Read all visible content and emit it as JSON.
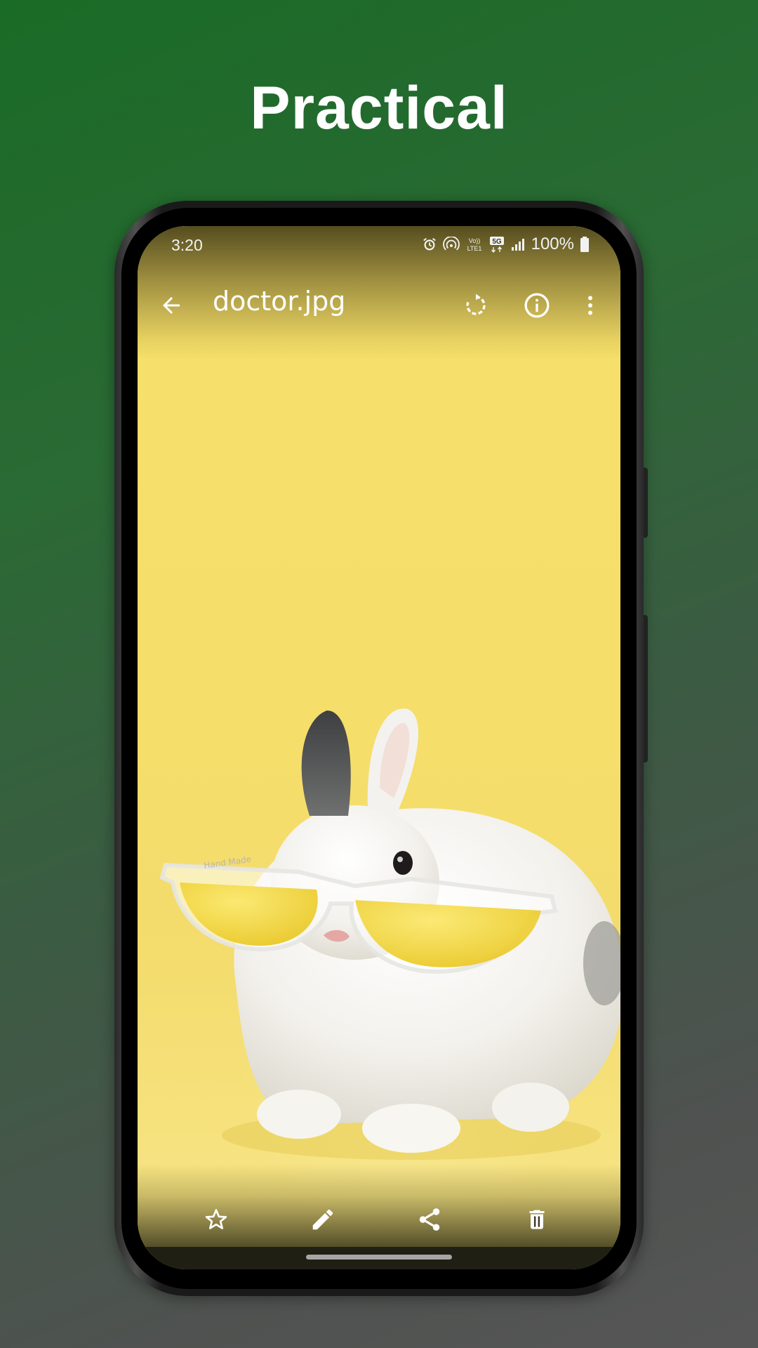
{
  "headline": "Practical",
  "status_bar": {
    "time": "3:20",
    "battery_percent": "100%",
    "icons": [
      "alarm-icon",
      "hotspot-icon",
      "volte-icon",
      "5g-icon",
      "signal-icon",
      "battery-icon"
    ],
    "volte_label_top": "Vo))",
    "volte_label_bottom": "LTE1",
    "fiveg_label": "5G"
  },
  "toolbar": {
    "title": "doctor.jpg",
    "icons": [
      "back-arrow-icon",
      "rotate-icon",
      "info-icon",
      "more-vert-icon"
    ]
  },
  "photo": {
    "subject": "white rabbit wearing yellow sunglasses on yellow background",
    "glasses_text": "Hand Made"
  },
  "bottom_actions": {
    "icons": [
      "star-icon",
      "edit-pencil-icon",
      "share-icon",
      "delete-icon"
    ]
  },
  "colors": {
    "background_top": "#1a6b26",
    "background_bottom": "#565656",
    "photo_yellow": "#f6e06a"
  }
}
